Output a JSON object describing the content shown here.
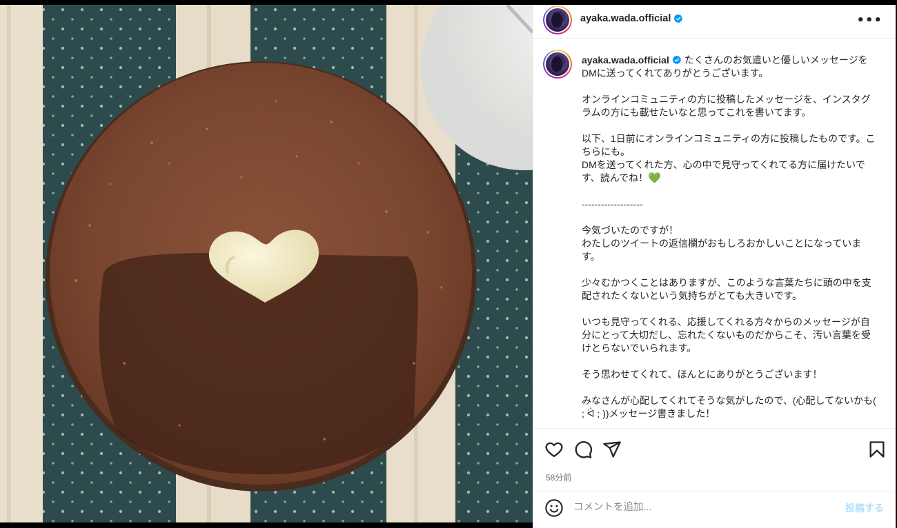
{
  "post": {
    "username": "ayaka.wada.official",
    "verified": true,
    "more_icon": "more-horizontal-icon",
    "image_alt": "tiramisu-with-white-chocolate-heart",
    "caption": {
      "author": "ayaka.wada.official",
      "paragraphs": [
        "たくさんのお気遣いと優しいメッセージをDMに送ってくれてありがとうございます。",
        "オンラインコミュニティの方に投稿したメッセージを、インスタグラムの方にも載せたいなと思ってこれを書いてます。",
        "以下、1日前にオンラインコミュニティの方に投稿したものです。こちらにも。\nDMを送ってくれた方、心の中で見守ってくれてる方に届けたいです、読んでね！",
        "-------------------",
        "今気づいたのですが！\nわたしのツイートの返信欄がおもしろおかしいことになっています。",
        "少々むかつくことはありますが、このような言葉たちに頭の中を支配されたくないという気持ちがとても大きいです。",
        "いつも見守ってくれる、応援してくれる方々からのメッセージが自分にとって大切だし、忘れたくないものだからこそ、汚い言葉を受けとらないでいられます。",
        "そう思わせてくれて、ほんとにありがとうございます！",
        "みなさんが心配してくれてそうな気がしたので、(心配してないかも( ; ᐛ ; ))メッセージ書きました！"
      ],
      "emoji": "💚",
      "emoji_color": "#2bb52b"
    },
    "time": "58分前"
  },
  "actions": {
    "like_icon": "heart-icon",
    "comment_icon": "comment-icon",
    "share_icon": "send-icon",
    "save_icon": "bookmark-icon"
  },
  "comment": {
    "placeholder": "コメントを追加...",
    "value": "",
    "post_label": "投稿する",
    "emoji_icon": "smiley-icon"
  },
  "colors": {
    "verified": "#0095f6",
    "post_button_disabled": "#b2dffc",
    "muted_text": "#737373"
  }
}
